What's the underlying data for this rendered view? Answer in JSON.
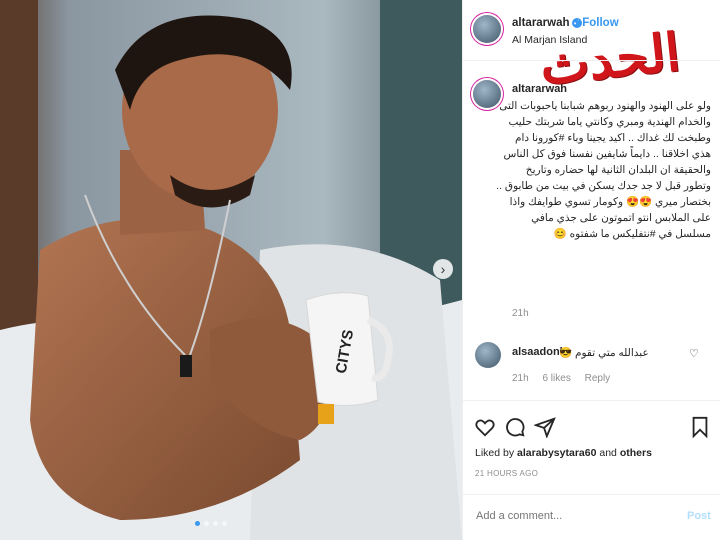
{
  "post": {
    "username": "altararwah",
    "follow_label": "Follow",
    "separator": "•",
    "location": "Al Marjan Island",
    "mug_text": "CITYS"
  },
  "caption": {
    "username": "altararwah",
    "text": "ولو على الهنود والهنود ربوهم شبابنا ياحبوبات التى والخدام الهندية ومبري وكانتي ياما شربتك حليب وطبخت لك غداك .. اكيد يجينا وباء #كورونا دام هذي اخلاقنا .. دايماً شايفين نفسنا فوق كل الناس والحقيقة ان البلدان الثانية لها حضاره وتاريخ وتطور قبل لا جد جدك يسكن في بيت من طابوق .. بختصار ميري 😍😍 وكومار تسوي طوايفك واذا على الملابس انتو اتموتون على جذي مافي مسلسل في #نتفليكس ما شفتوه 😊",
    "time": "21h"
  },
  "comment": {
    "username": "alsaadonly",
    "text": "😎 عبدالله متي تقوم",
    "time": "21h",
    "likes": "6 likes",
    "reply": "Reply"
  },
  "likes": {
    "prefix": "Liked by",
    "user": "alarabysytara60",
    "and": "and",
    "others": "others"
  },
  "timestamp": "21 HOURS AGO",
  "add_comment": {
    "placeholder": "Add a comment...",
    "post_label": "Post"
  },
  "watermark": "الحدث",
  "colors": {
    "accent": "#3897f0",
    "watermark": "#d0161b",
    "muted": "#8e8e8e"
  },
  "icons": [
    "heart-icon",
    "comment-icon",
    "share-icon",
    "save-icon",
    "chevron-right-icon",
    "verified-icon"
  ]
}
